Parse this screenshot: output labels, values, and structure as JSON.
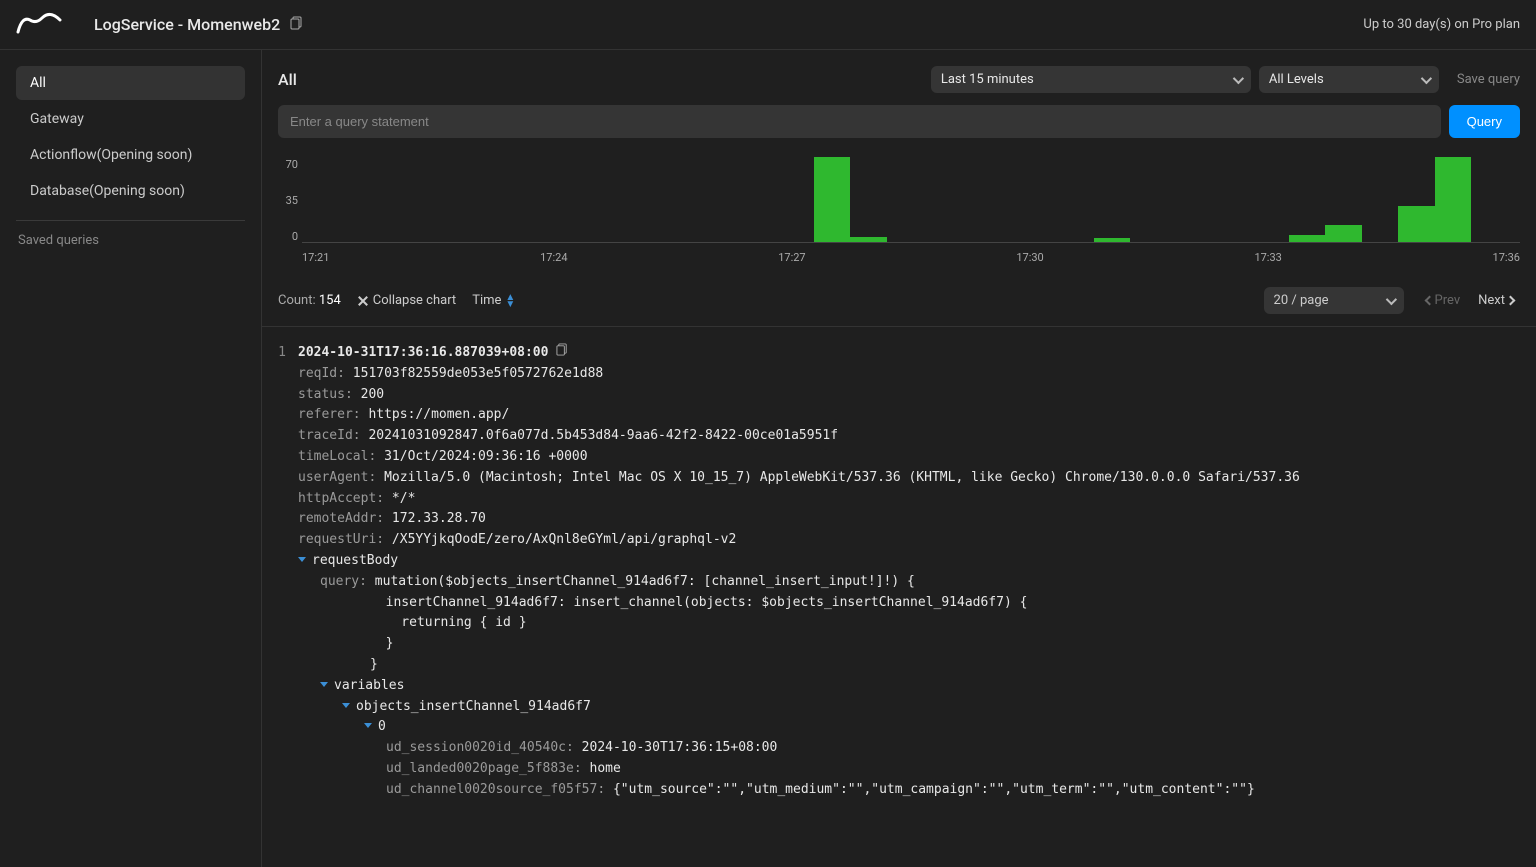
{
  "topbar": {
    "title": "LogService - Momenweb2",
    "plan": "Up to 30 day(s) on Pro plan"
  },
  "sidebar": {
    "items": [
      {
        "label": "All",
        "active": true
      },
      {
        "label": "Gateway"
      },
      {
        "label": "Actionflow(Opening soon)"
      },
      {
        "label": "Database(Opening soon)"
      }
    ],
    "saved_label": "Saved queries"
  },
  "header": {
    "title": "All",
    "time_range": "Last 15 minutes",
    "level": "All Levels",
    "save_query": "Save query",
    "query_placeholder": "Enter a query statement",
    "query_btn": "Query"
  },
  "chart_data": {
    "type": "bar",
    "ylim": [
      0,
      70
    ],
    "yticks": [
      70,
      35,
      0
    ],
    "x_ticks": [
      "17:21",
      "17:24",
      "17:27",
      "17:30",
      "17:33",
      "17:36"
    ],
    "bars": [
      {
        "left_pct": 42.0,
        "width_pct": 3.0,
        "value": 70
      },
      {
        "left_pct": 45.0,
        "width_pct": 3.0,
        "value": 4
      },
      {
        "left_pct": 65.0,
        "width_pct": 3.0,
        "value": 3
      },
      {
        "left_pct": 81.0,
        "width_pct": 3.0,
        "value": 6
      },
      {
        "left_pct": 84.0,
        "width_pct": 3.0,
        "value": 14
      },
      {
        "left_pct": 90.0,
        "width_pct": 3.0,
        "value": 30
      },
      {
        "left_pct": 93.0,
        "width_pct": 3.0,
        "value": 70
      }
    ]
  },
  "controls": {
    "count_label": "Count:",
    "count_value": "154",
    "collapse": "Collapse chart",
    "time_sort": "Time",
    "per_page": "20 / page",
    "prev": "Prev",
    "next": "Next"
  },
  "log": {
    "index": "1",
    "timestamp": "2024-10-31T17:36:16.887039+08:00",
    "fields": {
      "reqId": "151703f82559de053e5f0572762e1d88",
      "status": "200",
      "referer": "https://momen.app/",
      "traceId": "20241031092847.0f6a077d.5b453d84-9aa6-42f2-8422-00ce01a5951f",
      "timeLocal": "31/Oct/2024:09:36:16 +0000",
      "userAgent": "Mozilla/5.0 (Macintosh; Intel Mac OS X 10_15_7) AppleWebKit/537.36 (KHTML, like Gecko) Chrome/130.0.0.0 Safari/537.36",
      "httpAccept": "*/*",
      "remoteAddr": "172.33.28.70",
      "requestUri": "/X5YYjkqOodE/zero/AxQnl8eGYml/api/graphql-v2"
    },
    "requestBody_label": "requestBody",
    "query_key": "query:",
    "query_lines": [
      "mutation($objects_insertChannel_914ad6f7: [channel_insert_input!]!) {",
      "  insertChannel_914ad6f7: insert_channel(objects: $objects_insertChannel_914ad6f7) {",
      "    returning { id }",
      "  }",
      "}"
    ],
    "variables_label": "variables",
    "objects_label": "objects_insertChannel_914ad6f7",
    "zero_label": "0",
    "var_fields": {
      "ud_session0020id_40540c": "2024-10-30T17:36:15+08:00",
      "ud_landed0020page_5f883e": "home",
      "ud_channel0020source_f05f57": "{\"utm_source\":\"\",\"utm_medium\":\"\",\"utm_campaign\":\"\",\"utm_term\":\"\",\"utm_content\":\"\"}"
    }
  }
}
